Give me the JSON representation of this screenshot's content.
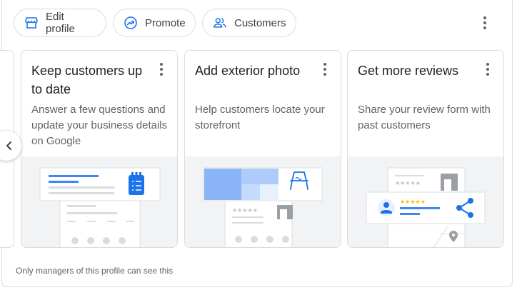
{
  "actions": {
    "edit_profile": "Edit profile",
    "promote": "Promote",
    "customers": "Customers"
  },
  "cards": [
    {
      "title": "Keep customers up to date",
      "description": "Answer a few questions and update your business details on Google",
      "illustration": "business-details-illustration"
    },
    {
      "title": "Add exterior photo",
      "description": "Help customers locate your storefront",
      "illustration": "storefront-photo-illustration"
    },
    {
      "title": "Get more reviews",
      "description": "Share your review form with past customers",
      "illustration": "review-share-illustration"
    }
  ],
  "footer": {
    "note": "Only managers of this profile can see this"
  },
  "colors": {
    "accent": "#1a73e8",
    "border": "#dadce0",
    "illustration_bg": "#f1f3f4",
    "star": "#fbbc04"
  },
  "icons": {
    "edit_profile": "storefront-icon",
    "promote": "trending-up-icon",
    "customers": "people-icon",
    "more": "more-vert-icon",
    "prev": "chevron-left-icon"
  }
}
